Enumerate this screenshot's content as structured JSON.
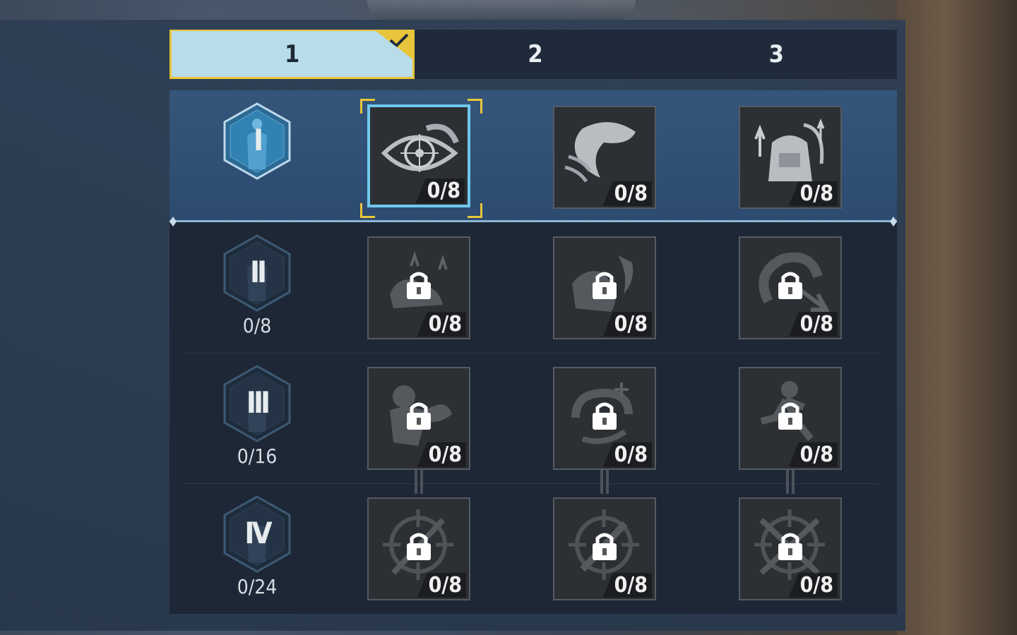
{
  "tabs": [
    {
      "label": "1",
      "active": true,
      "checked": true
    },
    {
      "label": "2",
      "active": false
    },
    {
      "label": "3",
      "active": false
    }
  ],
  "tiers": [
    {
      "numeral": "I",
      "count": "",
      "active": true,
      "skills": [
        {
          "icon": "eye-target-icon",
          "count": "0/8",
          "locked": false,
          "selected": true
        },
        {
          "icon": "sprint-dust-icon",
          "count": "0/8",
          "locked": false,
          "selected": false
        },
        {
          "icon": "backpack-upgrade-icon",
          "count": "0/8",
          "locked": false,
          "selected": false
        }
      ]
    },
    {
      "numeral": "II",
      "count": "0/8",
      "active": false,
      "skills": [
        {
          "icon": "boot-jump-icon",
          "count": "0/8",
          "locked": true
        },
        {
          "icon": "boot-flame-icon",
          "count": "0/8",
          "locked": true
        },
        {
          "icon": "spin-arrow-icon",
          "count": "0/8",
          "locked": true
        }
      ]
    },
    {
      "numeral": "III",
      "count": "0/16",
      "active": false,
      "skills": [
        {
          "icon": "strength-icon",
          "count": "0/8",
          "locked": true
        },
        {
          "icon": "heal-swirl-icon",
          "count": "0/8",
          "locked": true
        },
        {
          "icon": "runner-icon",
          "count": "0/8",
          "locked": true
        }
      ]
    },
    {
      "numeral": "IV",
      "count": "0/24",
      "active": false,
      "skills": [
        {
          "icon": "crosshair-rifle-icon",
          "count": "0/8",
          "locked": true
        },
        {
          "icon": "crosshair-smg-icon",
          "count": "0/8",
          "locked": true
        },
        {
          "icon": "crosshair-crossed-rifles-icon",
          "count": "0/8",
          "locked": true
        }
      ]
    }
  ],
  "colors": {
    "accent_yellow": "#e8c53a",
    "selected_border": "#70c7ec",
    "active_tab": "#b9dcea"
  }
}
